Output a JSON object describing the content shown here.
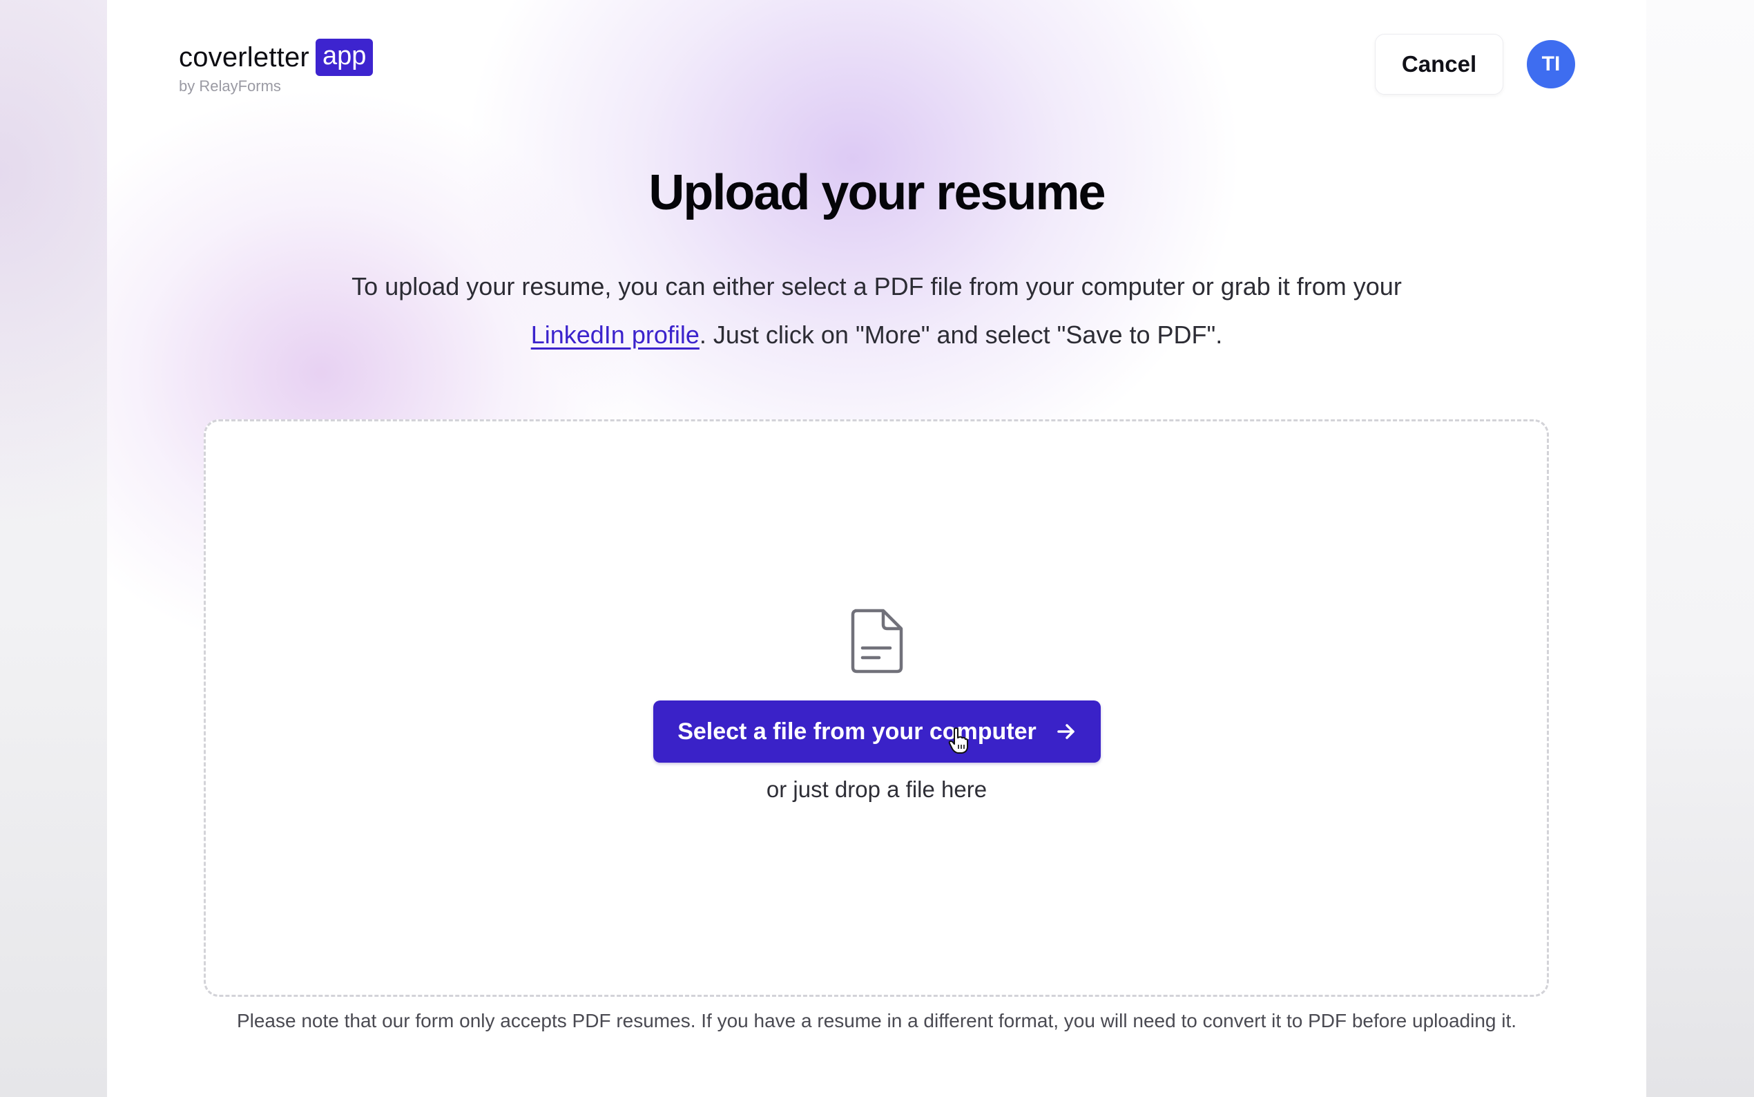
{
  "header": {
    "logo_word": "coverletter",
    "logo_badge": "app",
    "logo_subtitle": "by RelayForms",
    "cancel_label": "Cancel",
    "avatar_initials": "TI"
  },
  "main": {
    "title": "Upload your resume",
    "intro_before_link": "To upload your resume, you can either select a PDF file from your computer or grab it from your ",
    "intro_link": "LinkedIn profile",
    "intro_after_link": ". Just click on \"More\" and select \"Save to PDF\".",
    "upload": {
      "icon": "document-icon",
      "button_label": "Select a file from your computer",
      "button_icon": "arrow-right-icon",
      "drop_hint": "or just drop a file here"
    },
    "footnote": "Please note that our form only accepts PDF resumes. If you have a resume in a different format, you will need to convert it to PDF before uploading it."
  },
  "colors": {
    "brand": "#3a22c8",
    "avatar": "#3e6df0",
    "link": "#3b23cc"
  }
}
